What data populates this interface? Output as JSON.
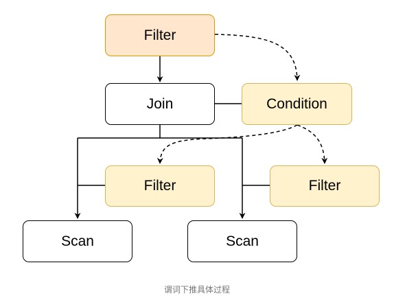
{
  "diagram": {
    "nodes": {
      "filter_top": "Filter",
      "join": "Join",
      "condition": "Condition",
      "filter_left": "Filter",
      "filter_right": "Filter",
      "scan_left": "Scan",
      "scan_right": "Scan"
    },
    "colors": {
      "plain_fill": "#ffffff",
      "plain_stroke": "#000000",
      "condition_fill": "#fff2cc",
      "condition_stroke": "#d6b656",
      "top_filter_fill": "#ffe6cc",
      "top_filter_stroke": "#d79b00"
    },
    "caption": "谓词下推具体过程"
  }
}
